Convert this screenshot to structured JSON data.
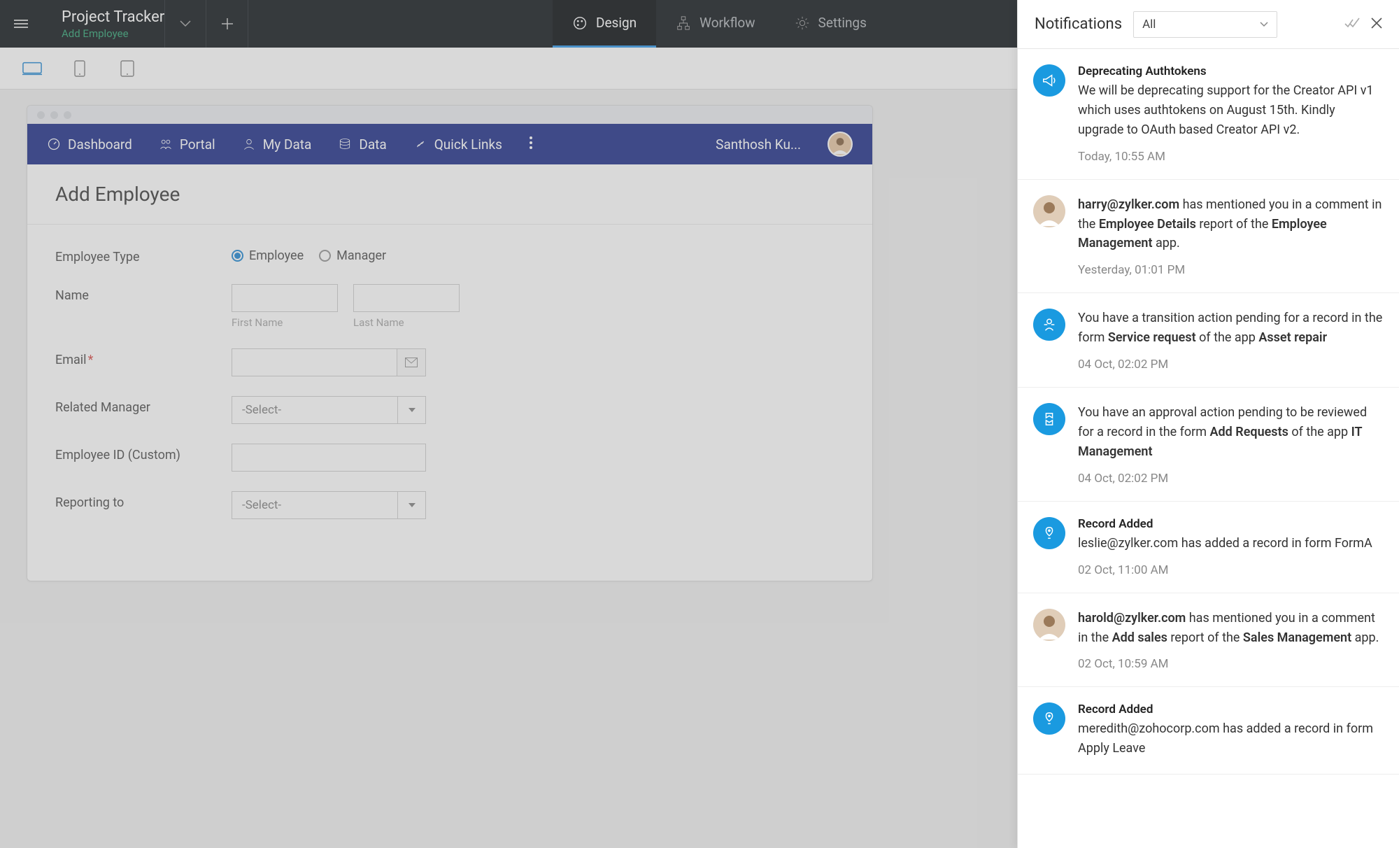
{
  "header": {
    "project_title": "Project Tracker",
    "project_sub": "Add Employee",
    "tabs": [
      {
        "label": "Design",
        "active": true
      },
      {
        "label": "Workflow",
        "active": false
      },
      {
        "label": "Settings",
        "active": false
      }
    ]
  },
  "app_nav": {
    "items": [
      {
        "label": "Dashboard"
      },
      {
        "label": "Portal"
      },
      {
        "label": "My Data"
      },
      {
        "label": "Data"
      },
      {
        "label": "Quick Links"
      }
    ],
    "user_name": "Santhosh Ku..."
  },
  "form": {
    "title": "Add Employee",
    "fields": {
      "employee_type": {
        "label": "Employee Type",
        "options": [
          {
            "label": "Employee",
            "checked": true
          },
          {
            "label": "Manager",
            "checked": false
          }
        ]
      },
      "name": {
        "label": "Name",
        "first_sub": "First Name",
        "last_sub": "Last Name",
        "first_value": "",
        "last_value": ""
      },
      "email": {
        "label": "Email",
        "required": true,
        "value": ""
      },
      "related_manager": {
        "label": "Related Manager",
        "placeholder": "-Select-"
      },
      "employee_id": {
        "label": "Employee ID (Custom)",
        "value": ""
      },
      "reporting_to": {
        "label": "Reporting to",
        "placeholder": "-Select-"
      }
    }
  },
  "notifications": {
    "title": "Notifications",
    "filter_value": "All",
    "items": [
      {
        "avatar_type": "blue",
        "avatar_icon": "megaphone",
        "heading": "Deprecating Authtokens",
        "segments": [
          {
            "t": "We will be deprecating support for the Creator API v1 which uses authtokens on August 15th. Kindly upgrade to OAuth based Creator API v2."
          }
        ],
        "time": "Today, 10:55 AM"
      },
      {
        "avatar_type": "img",
        "heading": "",
        "segments": [
          {
            "t": "harry@zylker.com",
            "b": true
          },
          {
            "t": " has mentioned you in a comment in the "
          },
          {
            "t": "Employee Details",
            "b": true
          },
          {
            "t": " report of the "
          },
          {
            "t": "Employee Management",
            "b": true
          },
          {
            "t": " app."
          }
        ],
        "time": "Yesterday, 01:01 PM"
      },
      {
        "avatar_type": "blue",
        "avatar_icon": "transition",
        "heading": "",
        "segments": [
          {
            "t": "You have a transition action pending for a record in the form "
          },
          {
            "t": "Service request",
            "b": true
          },
          {
            "t": " of the app "
          },
          {
            "t": "Asset repair",
            "b": true
          }
        ],
        "time": "04 Oct, 02:02 PM"
      },
      {
        "avatar_type": "blue",
        "avatar_icon": "approval",
        "heading": "",
        "segments": [
          {
            "t": "You have an approval action pending to be reviewed for a record in the form "
          },
          {
            "t": "Add Requests",
            "b": true
          },
          {
            "t": " of the app "
          },
          {
            "t": "IT Management",
            "b": true
          }
        ],
        "time": "04 Oct, 02:02 PM"
      },
      {
        "avatar_type": "blue",
        "avatar_icon": "record",
        "heading": "Record Added",
        "segments": [
          {
            "t": "leslie@zylker.com has added a record in form FormA"
          }
        ],
        "time": "02 Oct, 11:00 AM"
      },
      {
        "avatar_type": "img",
        "heading": "",
        "segments": [
          {
            "t": "harold@zylker.com",
            "b": true
          },
          {
            "t": " has mentioned you in a comment in the "
          },
          {
            "t": "Add sales",
            "b": true
          },
          {
            "t": " report of the "
          },
          {
            "t": "Sales Management",
            "b": true
          },
          {
            "t": " app."
          }
        ],
        "time": "02 Oct, 10:59 AM"
      },
      {
        "avatar_type": "blue",
        "avatar_icon": "record",
        "heading": "Record Added",
        "segments": [
          {
            "t": "meredith@zohocorp.com has added a record in form Apply Leave"
          }
        ],
        "time": ""
      }
    ]
  }
}
